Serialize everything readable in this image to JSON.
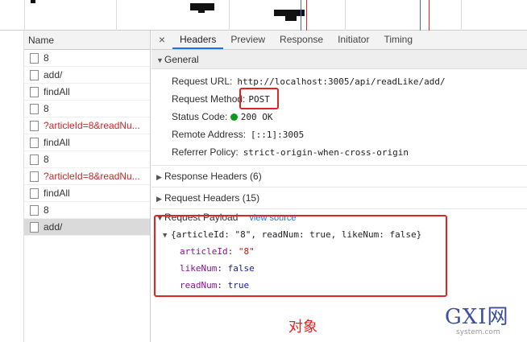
{
  "left_panel": {
    "header": "Name",
    "requests": [
      {
        "name": "8",
        "error": false,
        "selected": false
      },
      {
        "name": "add/",
        "error": false,
        "selected": false
      },
      {
        "name": "findAll",
        "error": false,
        "selected": false
      },
      {
        "name": "8",
        "error": false,
        "selected": false
      },
      {
        "name": "?articleId=8&readNu...",
        "error": true,
        "selected": false
      },
      {
        "name": "findAll",
        "error": false,
        "selected": false
      },
      {
        "name": "8",
        "error": false,
        "selected": false
      },
      {
        "name": "?articleId=8&readNu...",
        "error": true,
        "selected": false
      },
      {
        "name": "findAll",
        "error": false,
        "selected": false
      },
      {
        "name": "8",
        "error": false,
        "selected": false
      },
      {
        "name": "add/",
        "error": false,
        "selected": true
      }
    ]
  },
  "tabs": {
    "close": "×",
    "headers": "Headers",
    "preview": "Preview",
    "response": "Response",
    "initiator": "Initiator",
    "timing": "Timing",
    "active": "Headers"
  },
  "general": {
    "title": "General",
    "request_url_label": "Request URL:",
    "request_url": "http://localhost:3005/api/readLike/add/",
    "request_method_label": "Request Method:",
    "request_method": "POST",
    "status_code_label": "Status Code:",
    "status_code": "200 OK",
    "remote_address_label": "Remote Address:",
    "remote_address": "[::1]:3005",
    "referrer_policy_label": "Referrer Policy:",
    "referrer_policy": "strict-origin-when-cross-origin"
  },
  "sections": {
    "response_headers": "Response Headers (6)",
    "request_headers": "Request Headers (15)",
    "request_payload": "Request Payload",
    "view_source": "view source"
  },
  "payload": {
    "summary": "{articleId: \"8\", readNum: true, likeNum: false}",
    "props": [
      {
        "key": "articleId",
        "value": "\"8\"",
        "kind": "string"
      },
      {
        "key": "likeNum",
        "value": "false",
        "kind": "bool"
      },
      {
        "key": "readNum",
        "value": "true",
        "kind": "bool"
      }
    ]
  },
  "annotation": {
    "label": "对象",
    "color": "#e02424"
  },
  "watermark": {
    "top": "GXI网",
    "bottom": "system.com"
  },
  "colors": {
    "status_ok": "#0a9a1f",
    "error_text": "#c62828",
    "active_tab": "#1a73e8"
  }
}
